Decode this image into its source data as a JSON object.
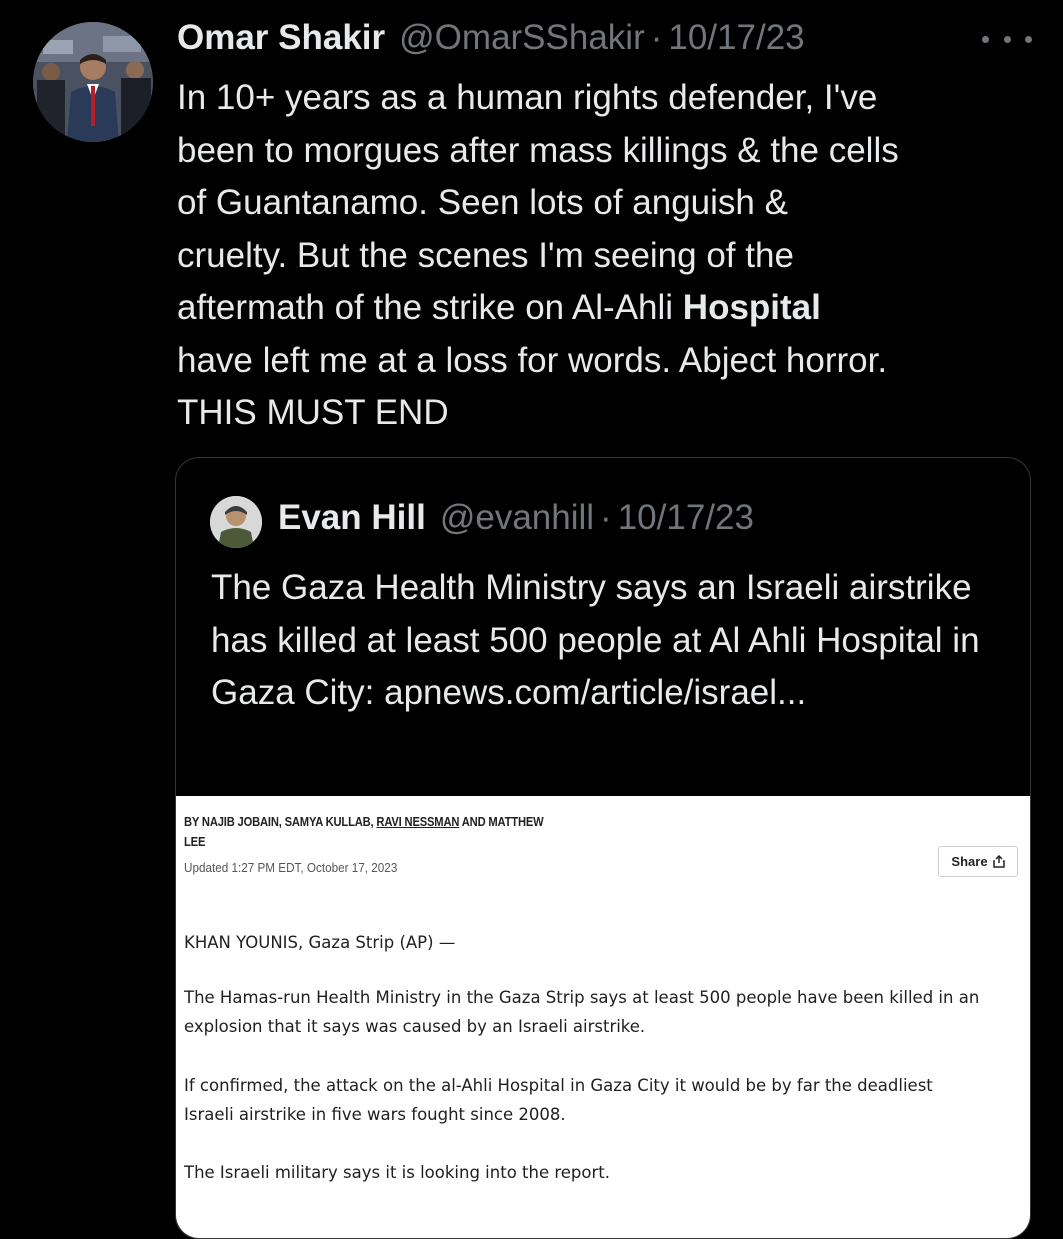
{
  "tweet": {
    "author_name": "Omar Shakir",
    "author_handle": "@OmarSShakir",
    "separator": "·",
    "date": "10/17/23",
    "text_before_bold": "In 10+ years as a human rights defender, I've\nbeen to morgues after mass killings & the cells\nof Guantanamo. Seen lots of anguish &\ncruelty. But the scenes I'm seeing of the\naftermath of the strike on Al-Ahli ",
    "text_bold": "Hospital",
    "text_after_bold": "\nhave left me at a loss for words. Abject horror.\nTHIS MUST END",
    "more_icon": "more-horizontal-icon"
  },
  "quote": {
    "author_name": "Evan Hill",
    "author_handle": "@evanhill",
    "separator": "·",
    "date": "10/17/23",
    "text": "The Gaza Health Ministry says an Israeli airstrike has killed at least 500 people at Al Ahli Hospital in Gaza City: apnews.com/article/israel...",
    "article": {
      "byline_1": "BY NAJIB JOBAIN, SAMYA KULLAB, ",
      "byline_link": "RAVI NESSMAN",
      "byline_2": " AND MATTHEW LEE",
      "updated": "Updated 1:27 PM EDT, October 17, 2023",
      "share_label": "Share",
      "share_icon": "share-icon",
      "dateline": "KHAN YOUNIS, Gaza Strip (AP) —",
      "paragraph_1": "The Hamas-run Health Ministry in the Gaza Strip says at least 500 people have been killed in an explosion that it says was caused by an Israeli airstrike.",
      "paragraph_2": "If confirmed, the attack on the al-Ahli Hospital in Gaza City it would be by far the deadliest Israeli airstrike in five wars fought since 2008.",
      "paragraph_3": "The Israeli military says it is looking into the report."
    }
  },
  "colors": {
    "background": "#000000",
    "text_primary": "#e7e9ea",
    "text_secondary": "#71767b",
    "border": "#333639",
    "article_bg": "#ffffff"
  }
}
